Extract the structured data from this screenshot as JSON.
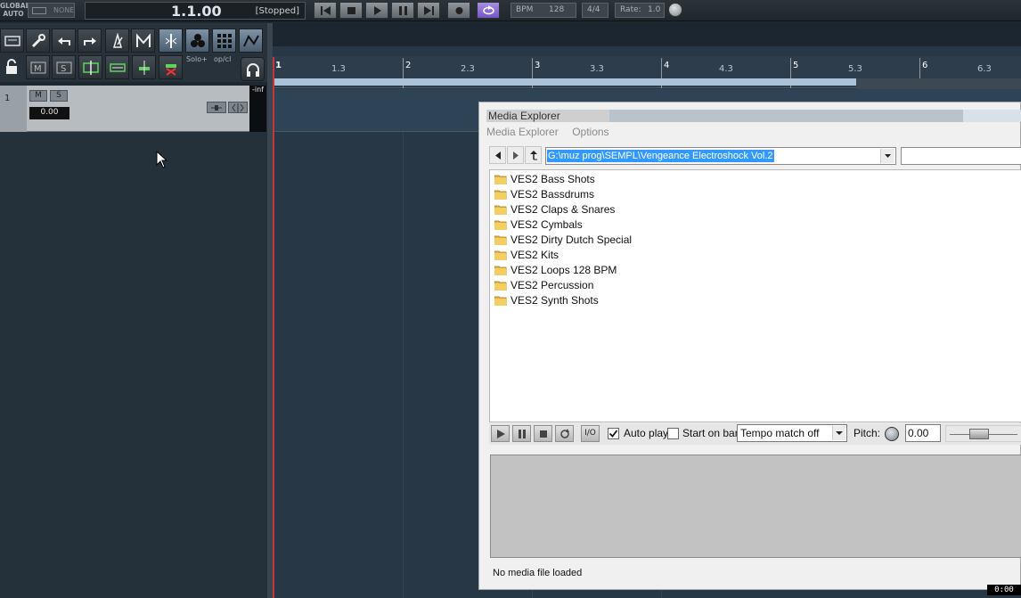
{
  "transport": {
    "global_auto": [
      "GLOBAL",
      "AUTO"
    ],
    "auto_mode": "NONE",
    "position": "1.1.00",
    "state": "[Stopped]",
    "bpm_label": "BPM",
    "bpm": "128",
    "time_sig": "4/4",
    "rate_label": "Rate:",
    "rate": "1.0"
  },
  "toolbar": {
    "solo_label": "Solo+",
    "op_label": "op/cl"
  },
  "track": {
    "number": "1",
    "mute": "M",
    "solo": "S",
    "volume": "0.00",
    "meter_peak": "-inf"
  },
  "ruler": {
    "labels": [
      "1",
      "1.3",
      "2",
      "2.3",
      "3",
      "3.3",
      "4",
      "4.3",
      "5",
      "5.3",
      "6",
      "6.3"
    ]
  },
  "media_explorer": {
    "title": "Media Explorer",
    "menu": [
      "Media Explorer",
      "Options"
    ],
    "path": "G:\\muz prog\\SEMPL\\Vengeance Electroshock Vol.2",
    "folders": [
      "VES2 Bass Shots",
      "VES2 Bassdrums",
      "VES2 Claps & Snares",
      "VES2 Cymbals",
      "VES2 Dirty Dutch Special",
      "VES2 Kits",
      "VES2 Loops 128 BPM",
      "VES2 Percussion",
      "VES2 Synth Shots"
    ],
    "io_label": "I/O",
    "auto_play_label": "Auto play",
    "auto_play_checked": true,
    "start_on_bar_label": "Start on bar",
    "start_on_bar_checked": false,
    "tempo_match": "Tempo match off",
    "pitch_label": "Pitch:",
    "pitch_value": "0.00",
    "status": "No media file loaded"
  },
  "corner_badge": "0:00",
  "colors": {
    "playhead": "#c0383c",
    "selection": "#3399ff",
    "loop_bar": "#aac3d9",
    "accent_purple": "#7455c4"
  }
}
